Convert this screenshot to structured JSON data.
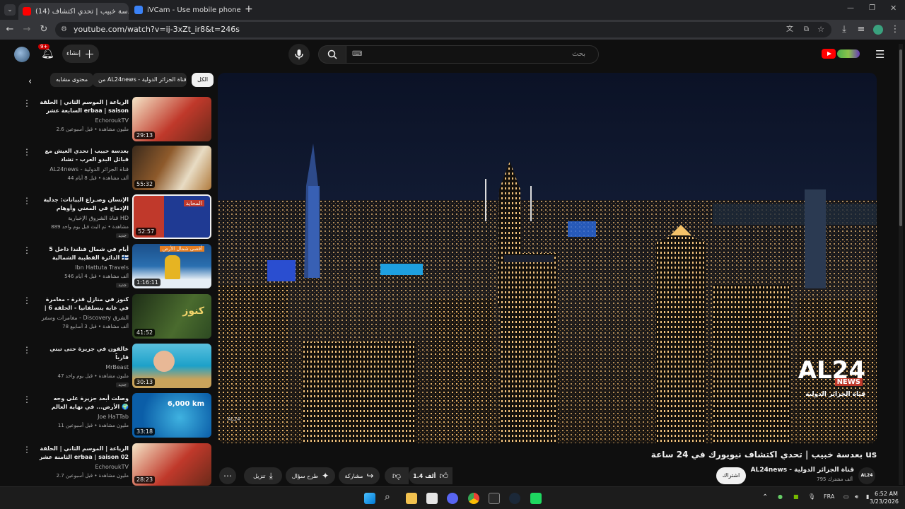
{
  "browser": {
    "tabs": [
      {
        "label": "(14) بعدسة خبيب | تحدي اكتشاف",
        "favicon_color": "#ff0000",
        "active": true
      },
      {
        "label": "iVCam - Use mobile phone as a",
        "favicon_color": "#3b82f6",
        "active": false
      }
    ],
    "url": "youtube.com/watch?v=ij-3xZt_ir8&t=246s"
  },
  "yt_header": {
    "search_placeholder": "بحث",
    "create_label": "إنشاء",
    "notif_count": "9+",
    "logo_text": "YouTube"
  },
  "chips": [
    {
      "label": "الكل",
      "selected": true
    },
    {
      "label": "من AL24news - قناة الجزائر الدولية",
      "selected": false
    },
    {
      "label": "محتوى مشابه",
      "selected": false
    }
  ],
  "related": [
    {
      "title": "الرياعة | الموسم الثاني | الحلقة السابعة عشر erbaa | saison 02 | Ep 17 | 17",
      "channel": "EchoroukTV",
      "meta": "2.6 مليون مشاهدة • قبل أسبوعين",
      "duration": "29:13",
      "badge": "",
      "colors": [
        "#c0392b",
        "#f5d76e"
      ]
    },
    {
      "title": "بعدسة خبيب | تحدي العيش مع قبائل البدو العرب - تشاد",
      "channel": "AL24news - قناة الجزائر الدولية",
      "meta": "44 ألف مشاهدة • قبل 8 أيام",
      "duration": "55:32",
      "badge": "",
      "colors": [
        "#8e5a2b",
        "#d9a066"
      ]
    },
    {
      "title": "الإنسان وصـراع البيانات: جدلية الإدماج في المغني وأوهام التمدن في الوطن | المحايد في...",
      "channel": "قناة الشروق الإخبارية HD",
      "meta": "889 مشاهدة • تم البث قبل يوم واحد",
      "duration": "52:57",
      "badge": "جديد",
      "colors": [
        "#1f3a93",
        "#c0392b"
      ]
    },
    {
      "title": "5 أيام في شمال فنلندا داخل الدائرة القطبية الشمالية 🇫🇮 التجربة كاملة",
      "channel": "Ibn Hattuta Travels",
      "meta": "546 ألف مشاهدة • قبل 4 أيام",
      "duration": "1:16:11",
      "badge": "جديد",
      "colors": [
        "#2a6fb0",
        "#e6b422"
      ]
    },
    {
      "title": "كنوز في منازل قذرة - مغامرة في غابة بنسلفانيا - الحلقة 6 | الشرق ديسكفري",
      "channel": "مغامرات وسفر - Discovery الشرق",
      "meta": "78 ألف مشاهدة • قبل 3 أسابيع",
      "duration": "41:52",
      "badge": "",
      "colors": [
        "#2d4a22",
        "#8ab34a"
      ]
    },
    {
      "title": "عالقون في جزيرة حتى تبني قارباً",
      "channel": "MrBeast",
      "meta": "47 مليون مشاهدة • قبل يوم واحد",
      "duration": "30:13",
      "badge": "جديد",
      "colors": [
        "#1da1c9",
        "#f0c419"
      ]
    },
    {
      "title": "وصلت أبعد جزيرة على وجه الأرض... في نهاية العالم 🌍",
      "channel": "Joe HaTTab",
      "meta": "11 مليون مشاهدة • قبل أسبوعين",
      "duration": "33:18",
      "badge": "",
      "colors": [
        "#0b5ea8",
        "#28a3d6"
      ]
    },
    {
      "title": "الرياعة | الموسم الثاني | الحلقة الثامنة عشر erbaa | saison 02 | Ep 18 | 18",
      "channel": "EchoroukTV",
      "meta": "2.7 مليون مشاهدة • قبل أسبوعين",
      "duration": "28:23",
      "badge": "",
      "colors": [
        "#c0392b",
        "#f5d76e"
      ]
    }
  ],
  "related_extra": {
    "badge_new": "جديد",
    "side_tag_3": "جديد",
    "thumb_text_2": "المحايد",
    "thumb_text_4": "أقصى شمال الأرض",
    "thumb_text_5": "كنوز",
    "thumb_text_7": "6,000 km"
  },
  "video": {
    "title": "بعدسة خبيب | تحدي اكتشاف نيويورك في 24 ساعة us",
    "channel": "AL24news - قناة الجزائر الدولية",
    "subscribers": "795 ألف مشترك",
    "subscribe_label": "اشتراك",
    "likes": "1.4 ألف",
    "share_label": "مشاركة",
    "ask_label": "طرح سؤال",
    "download_label": "تنزيل",
    "watermark_big": "AL24",
    "watermark_news": "NEWS",
    "watermark_sub": "قناة الجزائر الدولية",
    "avatar_text": "AL24"
  },
  "taskbar": {
    "lang": "FRA",
    "time": "6:52 AM",
    "date": "3/23/2026"
  }
}
